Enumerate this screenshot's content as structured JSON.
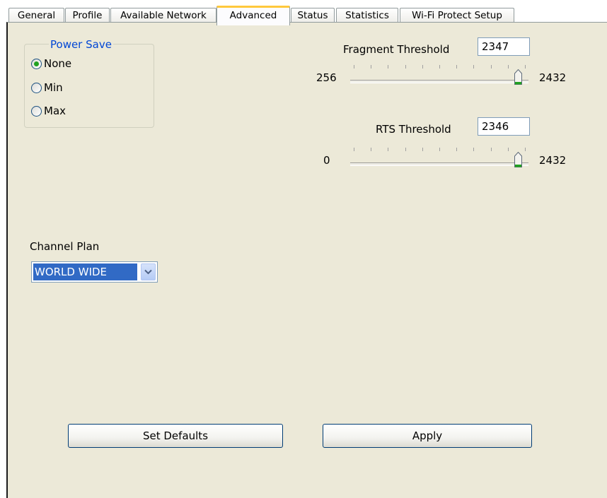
{
  "tabs": [
    {
      "label": "General"
    },
    {
      "label": "Profile"
    },
    {
      "label": "Available Network"
    },
    {
      "label": "Advanced"
    },
    {
      "label": "Status"
    },
    {
      "label": "Statistics"
    },
    {
      "label": "Wi-Fi Protect Setup"
    }
  ],
  "active_tab": "Advanced",
  "power_save": {
    "title": "Power Save",
    "options": [
      {
        "label": "None",
        "selected": true
      },
      {
        "label": "Min",
        "selected": false
      },
      {
        "label": "Max",
        "selected": false
      }
    ]
  },
  "fragment_threshold": {
    "label": "Fragment Threshold",
    "value": "2347",
    "min": "256",
    "max": "2432",
    "slider_value": 2347
  },
  "rts_threshold": {
    "label": "RTS Threshold",
    "value": "2346",
    "min": "0",
    "max": "2432",
    "slider_value": 2346
  },
  "channel_plan": {
    "label": "Channel Plan",
    "selected": "WORLD WIDE"
  },
  "buttons": {
    "set_defaults": "Set Defaults",
    "apply": "Apply"
  },
  "colors": {
    "panel_bg": "#ece9d8",
    "accent_blue": "#0046d5",
    "selection": "#316ac5",
    "tab_highlight": "#ffc83c",
    "thumb_green": "#21a121"
  },
  "icons": {
    "dropdown": "chevron-down-icon",
    "slider_thumb": "slider-thumb-icon"
  }
}
